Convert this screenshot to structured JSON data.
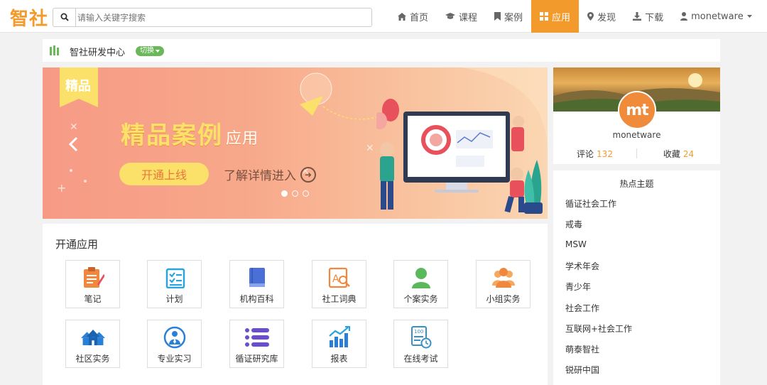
{
  "header": {
    "logo": "智社",
    "search_placeholder": "请输入关键字搜索",
    "nav": [
      {
        "label": "首页",
        "icon": "home-icon"
      },
      {
        "label": "课程",
        "icon": "graduation-cap-icon"
      },
      {
        "label": "案例",
        "icon": "bookmark-icon"
      },
      {
        "label": "应用",
        "icon": "grid-icon",
        "active": true
      },
      {
        "label": "发现",
        "icon": "map-pin-icon"
      },
      {
        "label": "下载",
        "icon": "download-icon"
      },
      {
        "label": "monetware",
        "icon": "user-icon"
      }
    ]
  },
  "org": {
    "name": "智社研发中心",
    "switch_label": "切换"
  },
  "banner": {
    "ribbon": "精品",
    "title": "精品案例",
    "title_suffix": "应用",
    "button": "开通上线",
    "learn_more": "了解详情进入"
  },
  "apps": {
    "title": "开通应用",
    "items": [
      {
        "label": "笔记",
        "icon": "notes-icon",
        "color": "#f0873c"
      },
      {
        "label": "计划",
        "icon": "checklist-icon",
        "color": "#2aa3e0"
      },
      {
        "label": "机构百科",
        "icon": "book-icon",
        "color": "#4a6fd6"
      },
      {
        "label": "社工词典",
        "icon": "dictionary-icon",
        "color": "#f0873c"
      },
      {
        "label": "个案实务",
        "icon": "person-icon",
        "color": "#5cb85c"
      },
      {
        "label": "小组实务",
        "icon": "group-icon",
        "color": "#f0873c"
      },
      {
        "label": "社区实务",
        "icon": "houses-icon",
        "color": "#2a80d6"
      },
      {
        "label": "专业实习",
        "icon": "intern-icon",
        "color": "#2a80d6"
      },
      {
        "label": "循证研究库",
        "icon": "list-icon",
        "color": "#6a4fc8"
      },
      {
        "label": "报表",
        "icon": "report-icon",
        "color": "#2a80d6"
      },
      {
        "label": "在线考试",
        "icon": "exam-icon",
        "color": "#3a8fc6"
      }
    ]
  },
  "profile": {
    "avatar_text": "mt",
    "name": "monetware",
    "comments_label": "评论",
    "comments": "132",
    "favorites_label": "收藏",
    "favorites": "24"
  },
  "topics": {
    "title": "热点主题",
    "items": [
      "循证社会工作",
      "戒毒",
      "MSW",
      "学术年会",
      "青少年",
      "社会工作",
      "互联网+社会工作",
      "萌泰智社",
      "锐研中国"
    ]
  }
}
